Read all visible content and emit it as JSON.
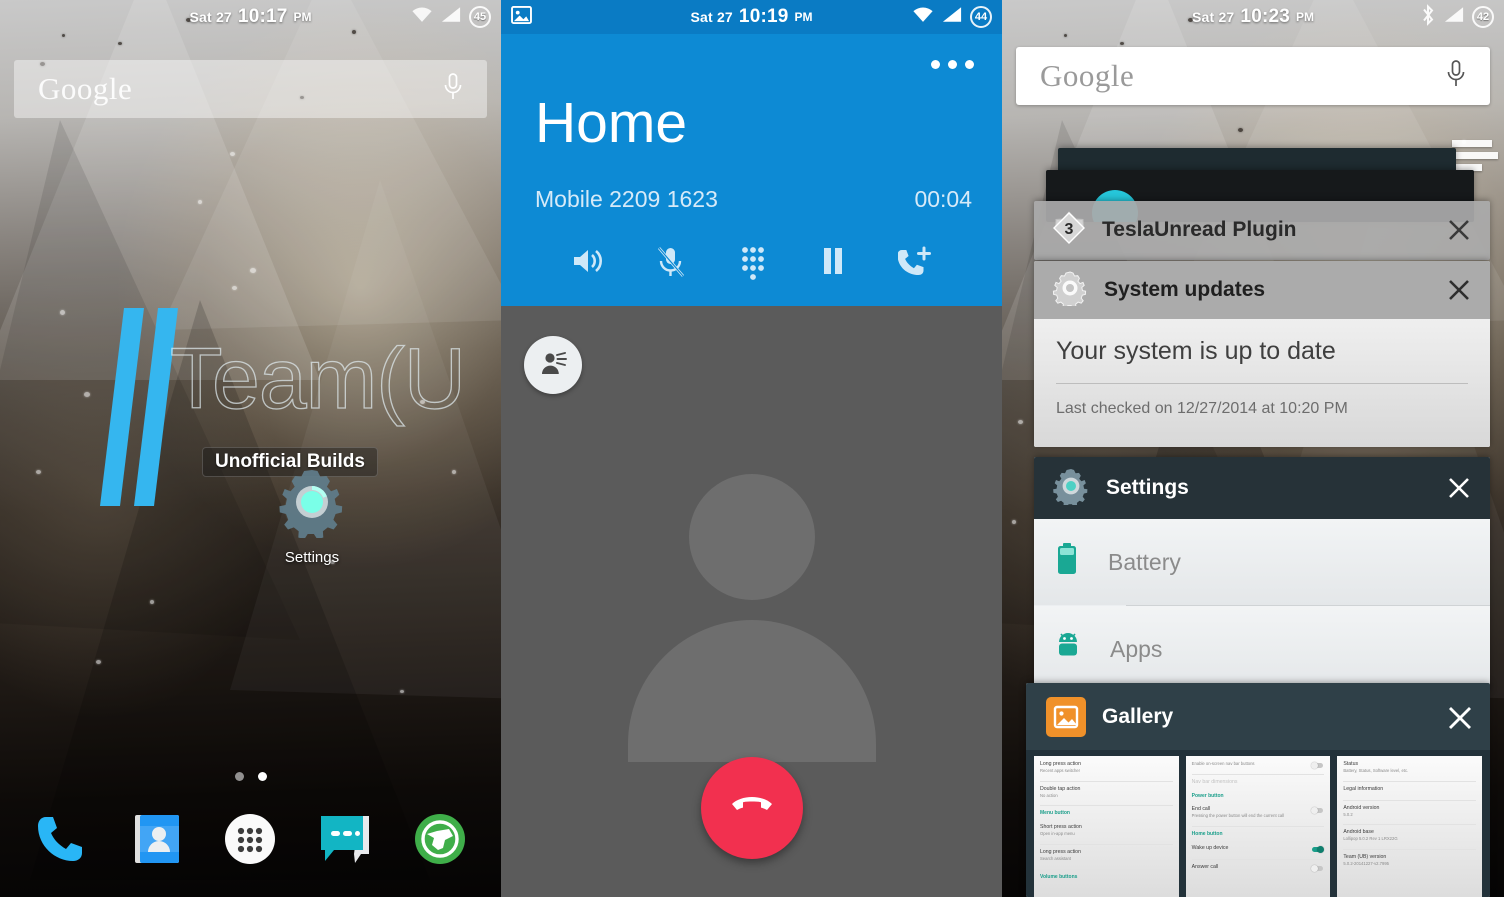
{
  "panels": {
    "home": {
      "status": {
        "date": "Sat 27",
        "time": "10:17",
        "ampm": "PM",
        "battery": "45",
        "wifi_icon": "wifi-icon",
        "signal_icon": "signal-icon"
      },
      "search": {
        "logo": "Google",
        "mic_icon": "microphone-icon"
      },
      "branding": {
        "wordmark": "Team(U",
        "badge": "Unofficial Builds"
      },
      "app": {
        "label": "Settings",
        "icon": "settings-gear-icon"
      },
      "page_dots": {
        "count": 2,
        "active_index": 1
      },
      "dock": [
        {
          "name": "phone",
          "label": "Phone",
          "icon": "phone-icon"
        },
        {
          "name": "contacts",
          "label": "Contacts",
          "icon": "contacts-icon"
        },
        {
          "name": "app-drawer",
          "label": "All apps",
          "icon": "app-drawer-icon"
        },
        {
          "name": "messaging",
          "label": "Messaging",
          "icon": "message-bubble-icon"
        },
        {
          "name": "browser",
          "label": "Browser",
          "icon": "globe-icon"
        }
      ]
    },
    "call": {
      "status": {
        "date": "Sat 27",
        "time": "10:19",
        "ampm": "PM",
        "battery": "44",
        "wifi_icon": "wifi-icon",
        "signal_icon": "signal-icon",
        "notification_icon": "image-notification-icon"
      },
      "overflow_label": "More options",
      "contact_name": "Home",
      "number_line": "Mobile 2209 1623",
      "duration": "00:04",
      "actions": [
        {
          "name": "speaker",
          "label": "Speaker",
          "icon": "speaker-icon"
        },
        {
          "name": "mute",
          "label": "Mute",
          "icon": "mic-off-icon"
        },
        {
          "name": "dialpad",
          "label": "Dialpad",
          "icon": "dialpad-icon"
        },
        {
          "name": "hold",
          "label": "Hold",
          "icon": "pause-icon"
        },
        {
          "name": "add-call",
          "label": "Add call",
          "icon": "add-call-icon"
        }
      ],
      "voice_fab_icon": "voice-person-icon",
      "end_call_label": "End call",
      "end_call_icon": "end-call-icon",
      "end_call_color": "#f2304f",
      "header_color": "#0d8ad4"
    },
    "recents": {
      "status": {
        "date": "Sat 27",
        "time": "10:23",
        "ampm": "PM",
        "battery": "42",
        "bluetooth_icon": "bluetooth-icon",
        "signal_icon": "signal-icon"
      },
      "search": {
        "logo": "Google",
        "mic_icon": "microphone-icon"
      },
      "cards": [
        {
          "name": "teslaunread",
          "title": "TeslaUnread Plugin",
          "badge": "3",
          "icon": "teslaunread-icon",
          "close_icon": "close-icon"
        },
        {
          "name": "system-updates",
          "title": "System updates",
          "icon": "gear-icon",
          "close_icon": "close-icon",
          "body_main": "Your system is up to date",
          "body_sub": "Last checked on 12/27/2014 at 10:20 PM"
        },
        {
          "name": "settings",
          "title": "Settings",
          "icon": "settings-gear-icon",
          "close_icon": "close-icon",
          "rows": [
            {
              "label": "Battery",
              "icon": "battery-icon"
            },
            {
              "label": "Apps",
              "icon": "android-icon"
            }
          ]
        },
        {
          "name": "gallery",
          "title": "Gallery",
          "icon": "gallery-image-icon",
          "close_icon": "close-icon",
          "thumbnail": {
            "col1": [
              {
                "title": "Long press action",
                "sub": "Recent apps switcher"
              },
              {
                "title": "Double tap action",
                "sub": "No action"
              },
              {
                "header": "Menu button"
              },
              {
                "title": "Short press action",
                "sub": "Open in-app menu"
              },
              {
                "title": "Long press action",
                "sub": "Search assistant"
              },
              {
                "header": "Volume buttons"
              }
            ],
            "col2": [
              {
                "sub": "Enable on-screen nav bar buttons",
                "toggle": "off"
              },
              {
                "dim": "Nav bar dimensions"
              },
              {
                "header": "Power button"
              },
              {
                "title": "End call",
                "sub": "Pressing the power button will end the current call",
                "toggle": "off"
              },
              {
                "header": "Home button"
              },
              {
                "title": "Wake up device",
                "toggle": "on"
              },
              {
                "title": "Answer call",
                "toggle": "off"
              }
            ],
            "col3": [
              {
                "title": "Status",
                "sub": "Battery, Status, Software level, etc."
              },
              {
                "title": "Legal information"
              },
              {
                "title": "Android version",
                "sub": "5.0.2"
              },
              {
                "title": "Android base",
                "sub": "Lollipop 5.0.2 Rev 1 LRX22G"
              },
              {
                "title": "Team (UB) version",
                "sub": "5.0.2-20141227-v2.7995"
              }
            ]
          }
        }
      ]
    }
  }
}
